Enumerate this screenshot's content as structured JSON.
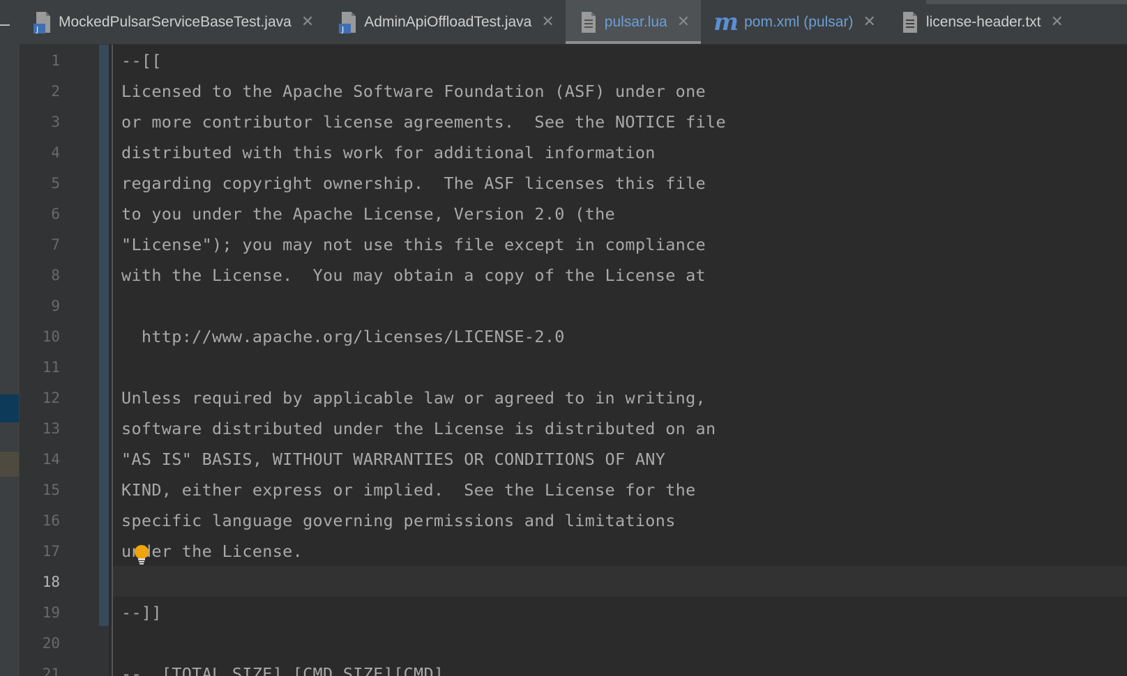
{
  "tabs": [
    {
      "label": "MockedPulsarServiceBaseTest.java",
      "icon": "java-file-icon",
      "active": false,
      "color": "#cfcfcf"
    },
    {
      "label": "AdminApiOffloadTest.java",
      "icon": "java-file-icon",
      "active": false,
      "color": "#cfcfcf"
    },
    {
      "label": "pulsar.lua",
      "icon": "text-file-icon",
      "active": true,
      "color": "#6a9fd8"
    },
    {
      "label": "pom.xml (pulsar)",
      "icon": "maven-icon",
      "active": false,
      "color": "#6a9fd8"
    },
    {
      "label": "license-header.txt",
      "icon": "text-file-icon",
      "active": false,
      "color": "#cfcfcf"
    }
  ],
  "close_glyph": "✕",
  "maven_glyph": "m",
  "editor": {
    "current_line": 18,
    "lines": [
      {
        "num": "1",
        "text": "--[["
      },
      {
        "num": "2",
        "text": "Licensed to the Apache Software Foundation (ASF) under one"
      },
      {
        "num": "3",
        "text": "or more contributor license agreements.  See the NOTICE file"
      },
      {
        "num": "4",
        "text": "distributed with this work for additional information"
      },
      {
        "num": "5",
        "text": "regarding copyright ownership.  The ASF licenses this file"
      },
      {
        "num": "6",
        "text": "to you under the Apache License, Version 2.0 (the"
      },
      {
        "num": "7",
        "text": "\"License\"); you may not use this file except in compliance"
      },
      {
        "num": "8",
        "text": "with the License.  You may obtain a copy of the License at"
      },
      {
        "num": "9",
        "text": ""
      },
      {
        "num": "10",
        "text": "  http://www.apache.org/licenses/LICENSE-2.0"
      },
      {
        "num": "11",
        "text": ""
      },
      {
        "num": "12",
        "text": "Unless required by applicable law or agreed to in writing,"
      },
      {
        "num": "13",
        "text": "software distributed under the License is distributed on an"
      },
      {
        "num": "14",
        "text": "\"AS IS\" BASIS, WITHOUT WARRANTIES OR CONDITIONS OF ANY"
      },
      {
        "num": "15",
        "text": "KIND, either express or implied.  See the License for the"
      },
      {
        "num": "16",
        "text": "specific language governing permissions and limitations"
      },
      {
        "num": "17",
        "text": "under the License."
      },
      {
        "num": "18",
        "text": ""
      },
      {
        "num": "19",
        "text": "--]]"
      },
      {
        "num": "20",
        "text": ""
      },
      {
        "num": "21",
        "text": "--  [TOTAL_SIZE] [CMD_SIZE][CMD]"
      }
    ]
  },
  "colors": {
    "background": "#2b2b2b",
    "gutter": "#313335",
    "tabbar": "#3c3f41",
    "active_tab": "#4e5254",
    "text": "#a9a9a9",
    "line_number": "#6a6a6a",
    "bulb": "#f0a30a"
  }
}
